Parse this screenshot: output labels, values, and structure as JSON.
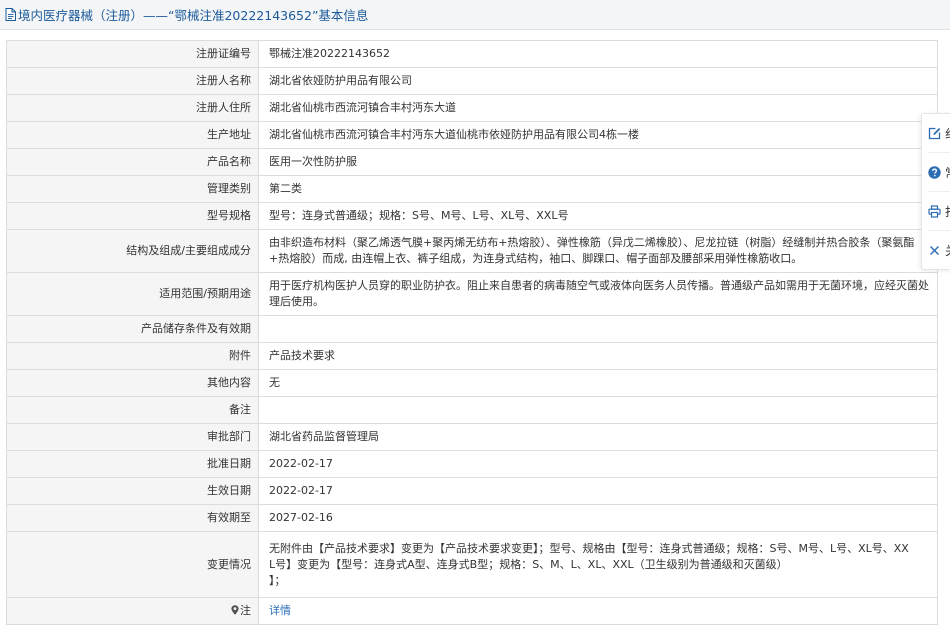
{
  "header": {
    "title": "境内医疗器械（注册）——“鄂械注准20222143652”基本信息"
  },
  "fields": [
    {
      "label": "注册证编号",
      "value": "鄂械注准20222143652"
    },
    {
      "label": "注册人名称",
      "value": "湖北省依娅防护用品有限公司"
    },
    {
      "label": "注册人住所",
      "value": "湖北省仙桃市西流河镇合丰村沔东大道"
    },
    {
      "label": "生产地址",
      "value": "湖北省仙桃市西流河镇合丰村沔东大道仙桃市依娅防护用品有限公司4栋一楼"
    },
    {
      "label": "产品名称",
      "value": "医用一次性防护服"
    },
    {
      "label": "管理类别",
      "value": "第二类"
    },
    {
      "label": "型号规格",
      "value": "型号：连身式普通级；规格：S号、M号、L号、XL号、XXL号"
    },
    {
      "label": "结构及组成/主要组成成分",
      "value": "由非织造布材料（聚乙烯透气膜+聚丙烯无纺布+热熔胶）、弹性橡筋（异戊二烯橡胶）、尼龙拉链（树脂）经缝制并热合胶条（聚氨酯+热熔胶）而成, 由连帽上衣、裤子组成，为连身式结构，袖口、脚踝口、帽子面部及腰部采用弹性橡筋收口。"
    },
    {
      "label": "适用范围/预期用途",
      "value": "用于医疗机构医护人员穿的职业防护衣。阻止来自患者的病毒随空气或液体向医务人员传播。普通级产品如需用于无菌环境，应经灭菌处理后使用。"
    },
    {
      "label": "产品储存条件及有效期",
      "value": ""
    },
    {
      "label": "附件",
      "value": "产品技术要求"
    },
    {
      "label": "其他内容",
      "value": "无"
    },
    {
      "label": "备注",
      "value": ""
    },
    {
      "label": "审批部门",
      "value": "湖北省药品监督管理局"
    },
    {
      "label": "批准日期",
      "value": "2022-02-17"
    },
    {
      "label": "生效日期",
      "value": "2022-02-17"
    },
    {
      "label": "有效期至",
      "value": "2027-02-16"
    },
    {
      "label": "变更情况",
      "value_lines": [
        "无附件由【产品技术要求】变更为【产品技术要求变更】；型号、规格由【型号：连身式普通级；规格：S号、M号、L号、XL号、XX",
        "L号】变更为【型号：连身式A型、连身式B型；规格：S、M、L、XL、XXL（卫生级别为普通级和灭菌级）",
        "】；"
      ]
    },
    {
      "label": "注",
      "link": "详情"
    }
  ],
  "toolbar": {
    "items": [
      {
        "icon": "edit-icon",
        "label": "纠"
      },
      {
        "icon": "help-icon",
        "label": "常"
      },
      {
        "icon": "print-icon",
        "label": "打"
      },
      {
        "icon": "close-icon",
        "label": "关"
      }
    ]
  },
  "colors": {
    "header_bg": "#f4f5f7",
    "title_text": "#1a5a9a",
    "label_bg": "#f5f5f5",
    "border": "#dcdcdc",
    "link": "#2a6db8",
    "toolbar_icon": "#2b6cb3"
  }
}
